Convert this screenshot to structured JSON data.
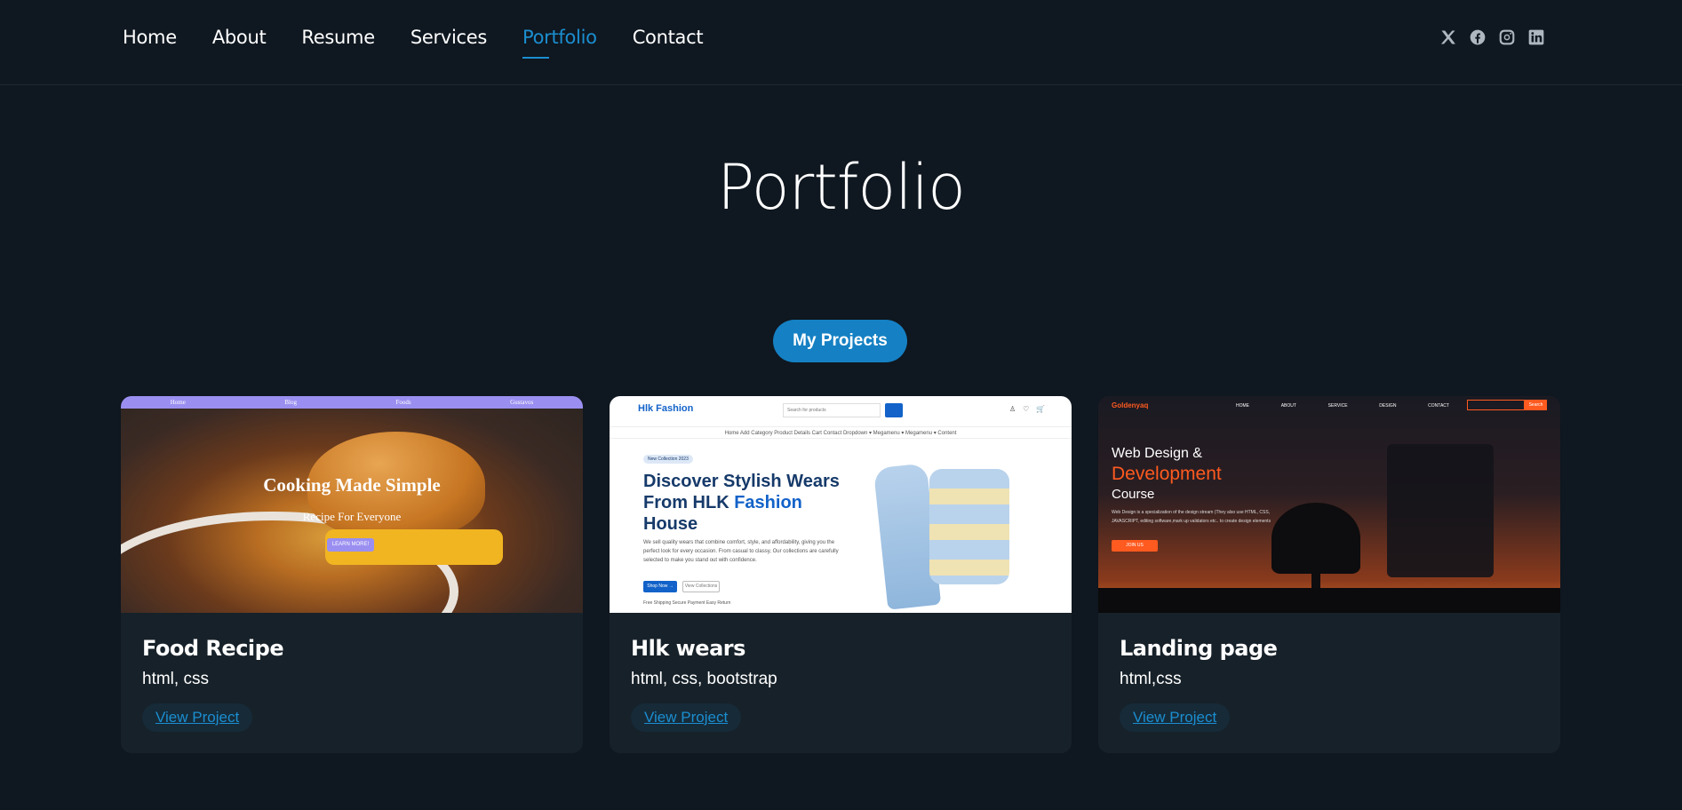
{
  "nav": {
    "items": [
      {
        "label": "Home"
      },
      {
        "label": "About"
      },
      {
        "label": "Resume"
      },
      {
        "label": "Services"
      },
      {
        "label": "Portfolio",
        "active": true
      },
      {
        "label": "Contact"
      }
    ]
  },
  "social": [
    "x-icon",
    "facebook-icon",
    "instagram-icon",
    "linkedin-icon"
  ],
  "page": {
    "title": "Portfolio",
    "filter_label": "My Projects"
  },
  "projects": [
    {
      "name": "Food Recipe",
      "tech": "html, css",
      "link_label": "View Project",
      "thumb": {
        "nav": [
          "Home",
          "Blog",
          "Foods",
          "Gustavos"
        ],
        "headline": "Cooking Made Simple",
        "sub": "Recipe For Everyone",
        "button": "LEARN MORE!"
      }
    },
    {
      "name": "Hlk wears",
      "tech": "html, css, bootstrap",
      "link_label": "View Project",
      "thumb": {
        "brand": "Hlk Fashion",
        "search_placeholder": "Search for products",
        "menu": "Home   Add   Category   Product Details   Cart   Contact   Dropdown ▾   Megamenu ▾   Megamenu ▾   Content",
        "tag": "New Collection 2023",
        "headline_a": "Discover Stylish Wears From HLK ",
        "headline_b": "Fashion",
        "headline_c": " House",
        "desc": "We sell quality wears that combine comfort, style, and affordability, giving you the perfect look for every occasion. From casual to classy, Our collections are carefully selected to make you stand out with confidence.",
        "btn_primary": "Shop Now →",
        "btn_secondary": "View Collections",
        "features": "Free Shipping   Secure Payment   Easy Return"
      }
    },
    {
      "name": "Landing page",
      "tech": "html,css",
      "link_label": "View Project",
      "thumb": {
        "brand": "Goldenyaq",
        "nav": [
          "HOME",
          "ABOUT",
          "SERVICE",
          "DESIGN",
          "CONTACT"
        ],
        "search_btn": "Search",
        "line1": "Web Design &",
        "line2": "Development",
        "line3": "Course",
        "desc": "Web Design is a specialization of the design stream (They also use HTML, CSS, JAVASCRIPT, editing software,mark up validators etc.. to create design elements",
        "join": "JOIN US"
      }
    }
  ],
  "colors": {
    "background": "#0f1720",
    "accent": "#1b8ed0",
    "card": "#172129"
  }
}
